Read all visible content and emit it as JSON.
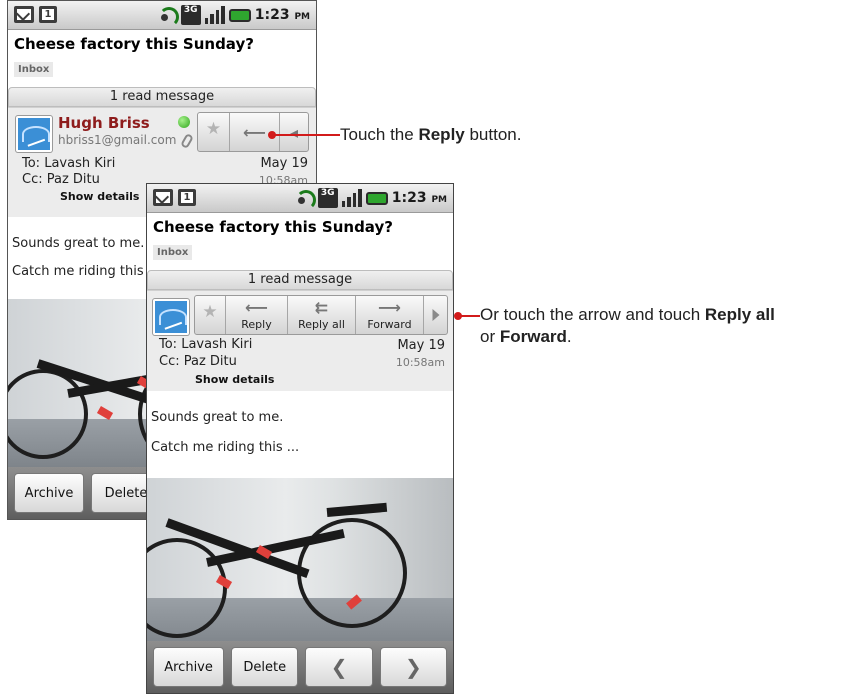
{
  "status_bar": {
    "time": "1:23",
    "ampm": "PM",
    "network": "3G"
  },
  "email": {
    "subject": "Cheese factory this Sunday?",
    "label": "Inbox",
    "read_count": "1 read message",
    "sender_name": "Hugh Briss",
    "sender_email": "hbriss1@gmail.com",
    "to": "To: Lavash Kiri",
    "cc": "Cc: Paz Ditu",
    "show_details": "Show details",
    "date": "May 19",
    "time": "10:58am",
    "body_line1": "Sounds great to me.",
    "body_line2_full": "Catch me riding this ...",
    "body_line2_truncated": "Catch me riding this .."
  },
  "actions": {
    "reply": "Reply",
    "reply_all": "Reply all",
    "forward": "Forward"
  },
  "bottom_bar": {
    "archive": "Archive",
    "delete": "Delete",
    "delete_truncated": "Delete",
    "prev_icon": "chevron-left-icon",
    "next_icon": "chevron-right-icon"
  },
  "callouts": {
    "c1_pre": "Touch the ",
    "c1_bold": "Reply",
    "c1_post": " button.",
    "c2_pre": "Or touch the arrow and touch ",
    "c2_bold1": "Reply all",
    "c2_mid": "or ",
    "c2_bold2": "Forward",
    "c2_post": "."
  },
  "colors": {
    "callout_red": "#d21b1b",
    "sender_name": "#8e1c1c",
    "online_dot": "#2fa51c"
  }
}
